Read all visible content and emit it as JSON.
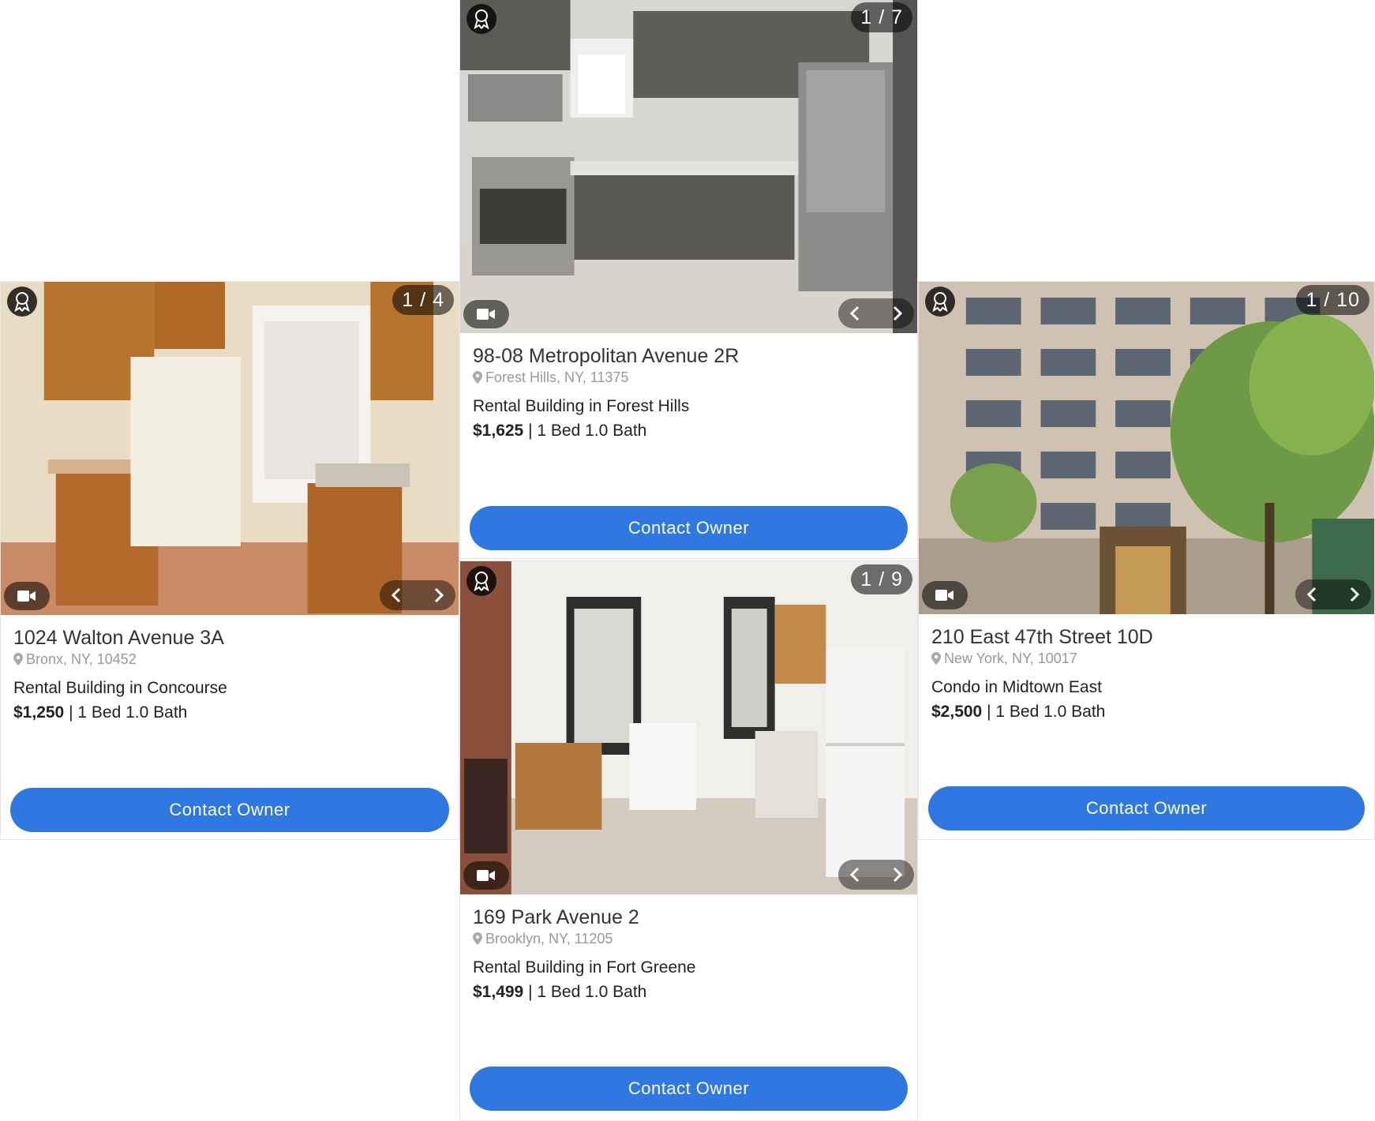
{
  "listings": [
    {
      "title": "1024 Walton Avenue 3A",
      "location": "Bronx, NY, 10452",
      "building_type": "Rental Building in Concourse",
      "price": "$1,250",
      "beds_baths": "1 Bed 1.0 Bath",
      "photo_counter": "1 / 4",
      "cta": "Contact Owner"
    },
    {
      "title": "98-08 Metropolitan Avenue 2R",
      "location": "Forest Hills, NY, 11375",
      "building_type": "Rental Building in Forest Hills",
      "price": "$1,625",
      "beds_baths": "1 Bed 1.0 Bath",
      "photo_counter": "1 / 7",
      "cta": "Contact Owner"
    },
    {
      "title": "169 Park Avenue 2",
      "location": "Brooklyn, NY, 11205",
      "building_type": "Rental Building in Fort Greene",
      "price": "$1,499",
      "beds_baths": "1 Bed 1.0 Bath",
      "photo_counter": "1 / 9",
      "cta": "Contact Owner"
    },
    {
      "title": "210 East 47th Street 10D",
      "location": "New York, NY, 10017",
      "building_type": "Condo in Midtown East",
      "price": "$2,500",
      "beds_baths": "1 Bed 1.0 Bath",
      "photo_counter": "1 / 10",
      "cta": "Contact Owner"
    }
  ],
  "separator": "|",
  "icons": {
    "badge": "award-ribbon-icon",
    "video": "video-camera-icon",
    "prev": "chevron-left-icon",
    "next": "chevron-right-icon",
    "location": "map-pin-icon"
  },
  "colors": {
    "accent": "#2f78e1"
  }
}
